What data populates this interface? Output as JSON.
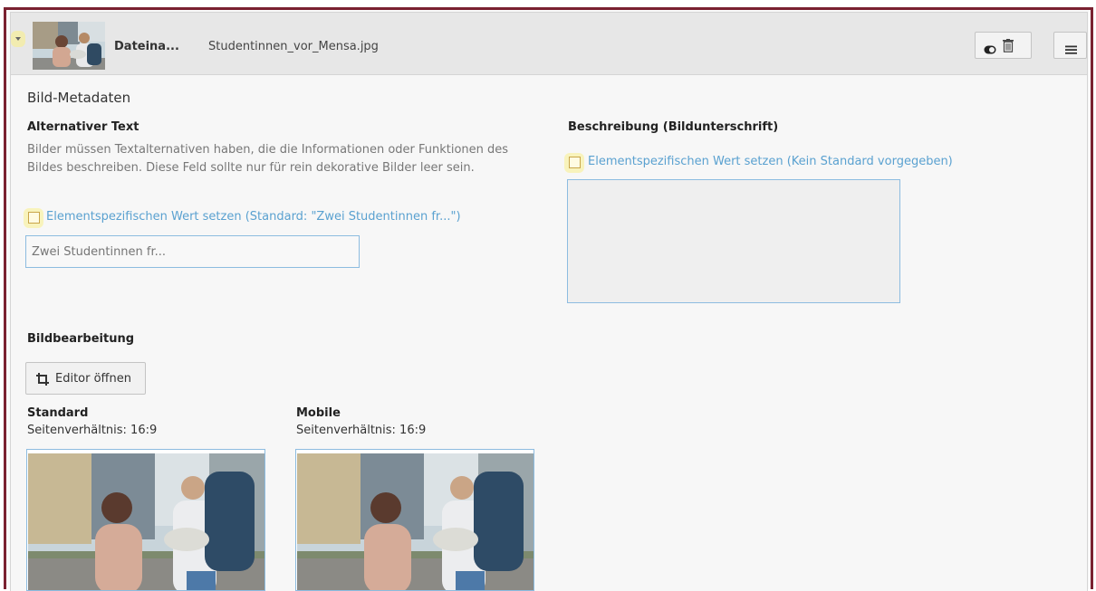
{
  "header": {
    "label": "Dateina...",
    "filename": "Studentinnen_vor_Mensa.jpg",
    "toggle_icon": "toggle-icon",
    "delete_icon": "trash-icon",
    "menu_icon": "hamburger-menu-icon"
  },
  "metadata": {
    "section_title": "Bild-Metadaten",
    "alt_text": {
      "label": "Alternativer Text",
      "help": "Bilder müssen Textalternativen haben, die die Informationen oder Funktionen des Bildes beschreiben. Diese Feld sollte nur für rein dekorative Bilder leer sein.",
      "checkbox_label": "Elementspezifischen Wert setzen (Standard: \"Zwei Studentinnen fr...\")",
      "placeholder": "Zwei Studentinnen fr..."
    },
    "description": {
      "label": "Beschreibung (Bildunterschrift)",
      "checkbox_label": "Elementspezifischen Wert setzen (Kein Standard vorgegeben)"
    }
  },
  "editing": {
    "title": "Bildbearbeitung",
    "editor_button": "Editor öffnen",
    "crops": [
      {
        "title": "Standard",
        "ratio": "Seitenverhältnis: 16:9"
      },
      {
        "title": "Mobile",
        "ratio": "Seitenverhältnis: 16:9"
      }
    ]
  },
  "colors": {
    "frame_border": "#7a2130",
    "link": "#5aa1d0",
    "field_border": "#8dbce0"
  }
}
